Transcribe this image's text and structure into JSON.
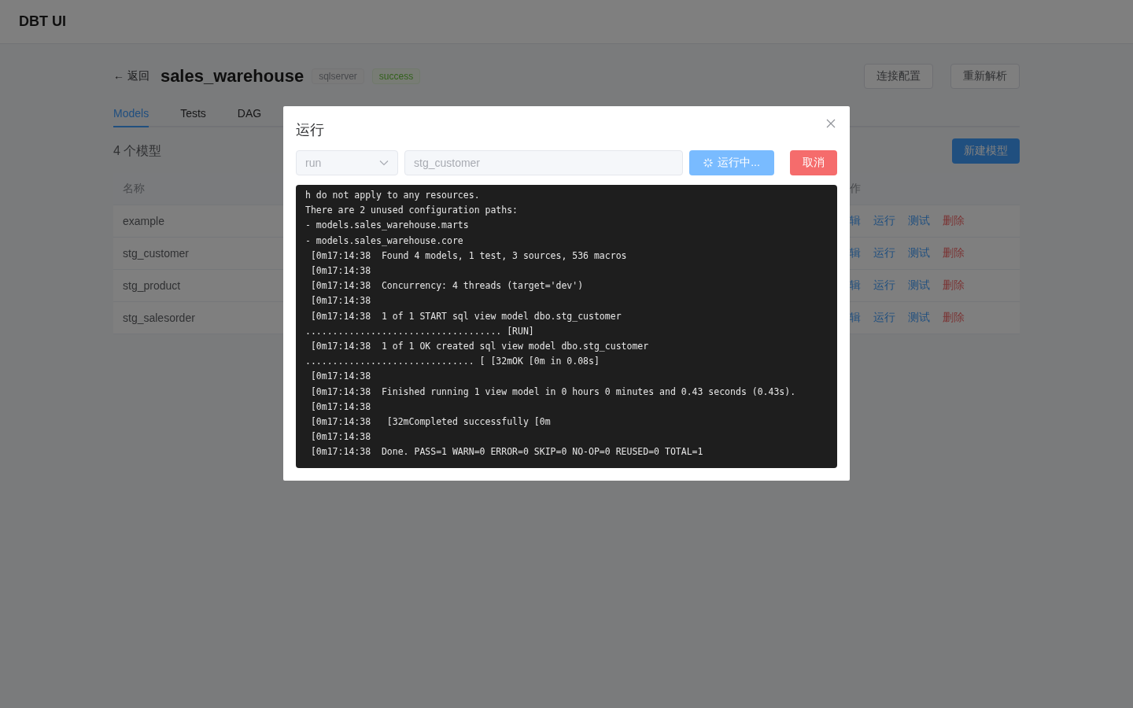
{
  "app": {
    "title": "DBT UI"
  },
  "project": {
    "back": "← 返回",
    "name": "sales_warehouse",
    "tags": [
      {
        "label": "sqlserver",
        "kind": "info"
      },
      {
        "label": "success",
        "kind": "success"
      }
    ],
    "buttons": [
      "连接配置",
      "重新解析"
    ]
  },
  "tabs": [
    {
      "label": "Models",
      "selected": true
    },
    {
      "label": "Tests",
      "selected": false
    },
    {
      "label": "DAG",
      "selected": false
    }
  ],
  "model_count": "4 个模型",
  "new_model_button": "新建模型",
  "table": {
    "columns": [
      "名称",
      "作"
    ],
    "rows": [
      {
        "name": "example",
        "actions": [
          {
            "label": "辑",
            "kind": "link"
          },
          {
            "label": "运行",
            "kind": "link"
          },
          {
            "label": "测试",
            "kind": "link"
          },
          {
            "label": "删除",
            "kind": "danger"
          }
        ]
      },
      {
        "name": "stg_customer",
        "actions": [
          {
            "label": "辑",
            "kind": "link"
          },
          {
            "label": "运行",
            "kind": "link"
          },
          {
            "label": "测试",
            "kind": "link"
          },
          {
            "label": "删除",
            "kind": "danger"
          }
        ]
      },
      {
        "name": "stg_product",
        "actions": [
          {
            "label": "辑",
            "kind": "link"
          },
          {
            "label": "运行",
            "kind": "link"
          },
          {
            "label": "测试",
            "kind": "link"
          },
          {
            "label": "删除",
            "kind": "danger"
          }
        ]
      },
      {
        "name": "stg_salesorder",
        "actions": [
          {
            "label": "辑",
            "kind": "link"
          },
          {
            "label": "运行",
            "kind": "link"
          },
          {
            "label": "测试",
            "kind": "link"
          },
          {
            "label": "删除",
            "kind": "danger"
          }
        ]
      }
    ]
  },
  "dialog": {
    "title": "运行",
    "command": {
      "value": "run",
      "disabled": true
    },
    "model": {
      "value": "stg_customer",
      "disabled": true
    },
    "run_button": {
      "label": "运行中...",
      "loading": true
    },
    "cancel_button": "取消",
    "log": [
      "h do not apply to any resources.",
      "There are 2 unused configuration paths:",
      "- models.sales_warehouse.marts",
      "- models.sales_warehouse.core",
      " [0m17:14:38  Found 4 models, 1 test, 3 sources, 536 macros",
      " [0m17:14:38",
      " [0m17:14:38  Concurrency: 4 threads (target='dev')",
      " [0m17:14:38",
      " [0m17:14:38  1 of 1 START sql view model dbo.stg_customer",
      ".................................... [RUN]",
      " [0m17:14:38  1 of 1 OK created sql view model dbo.stg_customer",
      "............................... [ [32mOK [0m in 0.08s]",
      " [0m17:14:38",
      " [0m17:14:38  Finished running 1 view model in 0 hours 0 minutes and 0.43 seconds (0.43s).",
      " [0m17:14:38",
      " [0m17:14:38   [32mCompleted successfully [0m",
      " [0m17:14:38",
      " [0m17:14:38  Done. PASS=1 WARN=0 ERROR=0 SKIP=0 NO-OP=0 REUSED=0 TOTAL=1"
    ]
  }
}
